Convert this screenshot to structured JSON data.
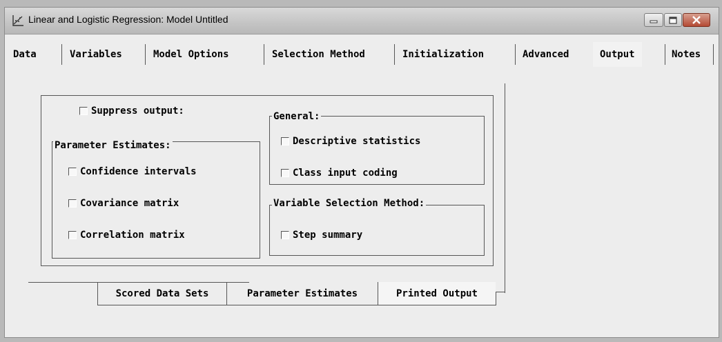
{
  "window": {
    "title": "Linear and Logistic Regression: Model Untitled",
    "controls": {
      "minimize": "minimize",
      "maximize": "maximize",
      "close": "close"
    }
  },
  "tabs": [
    {
      "label": "Data"
    },
    {
      "label": "Variables"
    },
    {
      "label": "Model Options"
    },
    {
      "label": "Selection Method"
    },
    {
      "label": "Initialization"
    },
    {
      "label": "Advanced"
    },
    {
      "label": "Output",
      "active": true
    },
    {
      "label": "Notes"
    }
  ],
  "output_panel": {
    "suppress_output": {
      "label": "Suppress output:",
      "checked": false
    },
    "parameter_estimates": {
      "legend": "Parameter Estimates:",
      "items": [
        {
          "label": "Confidence intervals",
          "checked": false
        },
        {
          "label": "Covariance matrix",
          "checked": false
        },
        {
          "label": "Correlation matrix",
          "checked": false
        }
      ]
    },
    "general": {
      "legend": "General:",
      "items": [
        {
          "label": "Descriptive statistics",
          "checked": false
        },
        {
          "label": "Class input coding",
          "checked": false
        }
      ]
    },
    "variable_selection": {
      "legend": "Variable Selection Method:",
      "items": [
        {
          "label": "Step summary",
          "checked": false
        }
      ]
    }
  },
  "subtabs": [
    {
      "label": "Scored Data Sets"
    },
    {
      "label": "Parameter Estimates"
    },
    {
      "label": "Printed Output",
      "active": true
    }
  ],
  "colors": {
    "window_bg": "#ededed",
    "titlebar": "#c8c8c8",
    "close_button": "#b44a34",
    "text": "#000000"
  },
  "icons": {
    "app": "regression-chart-icon"
  }
}
